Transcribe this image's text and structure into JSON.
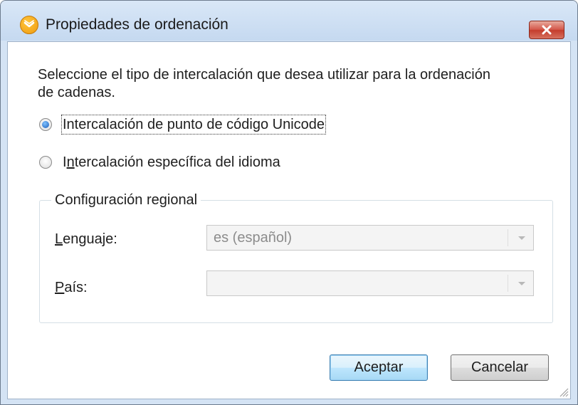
{
  "window": {
    "title": "Propiedades de ordenación",
    "app_icon": "altova-mapforce-icon",
    "close_icon": "close-x-icon",
    "colors": {
      "close_button": "#c43c2c",
      "frame": "#d4e3f4",
      "default_button": "#3c7fb1"
    }
  },
  "prompt": {
    "line1": "Seleccione el tipo de intercalación que desea utilizar para la ordenación",
    "line2": "de cadenas."
  },
  "options": {
    "unicode": {
      "label": "Intercalación de punto de código Unicode",
      "checked": true
    },
    "language": {
      "label_mnemonic": "n",
      "label_first": "I",
      "label_rest": "tercalación específica del idioma",
      "checked": false
    }
  },
  "regional": {
    "legend": "Configuración regional",
    "language_label_mnemonic": "L",
    "language_label_rest": "enguaje:",
    "language_value": "es (español)",
    "country_label_mnemonic": "P",
    "country_label_rest": "aís:",
    "country_value": ""
  },
  "buttons": {
    "ok": "Aceptar",
    "cancel": "Cancelar"
  }
}
